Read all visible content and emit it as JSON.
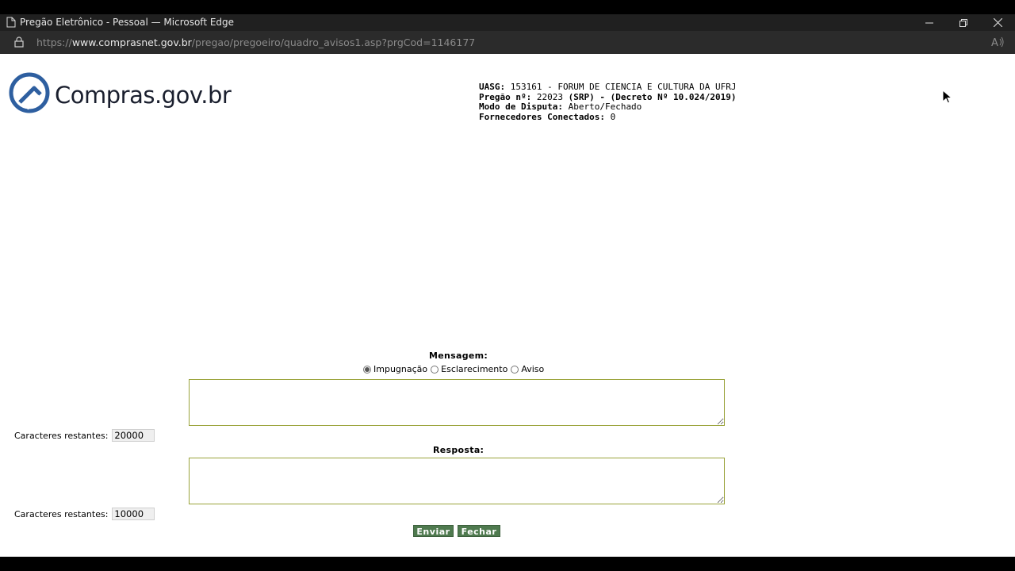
{
  "window": {
    "title": "Pregão Eletrônico - Pessoal — Microsoft Edge"
  },
  "address_bar": {
    "url_prefix": "https://",
    "url_host": "www.comprasnet.gov.br",
    "url_path": "/pregao/pregoeiro/quadro_avisos1.asp?prgCod=1146177"
  },
  "logo": {
    "text": "Compras.gov.br",
    "color": "#2e5fa0"
  },
  "info": {
    "uasg_label": "UASG:",
    "uasg_value": " 153161 - FORUM DE CIENCIA E CULTURA DA UFRJ",
    "pregao_label": "Pregão nº:",
    "pregao_number": " 22023 ",
    "pregao_extra": "(SRP) - (Decreto Nº 10.024/2019)",
    "modo_label": "Modo de Disputa:",
    "modo_value": " Aberto/Fechado",
    "fornecedores_label": "Fornecedores Conectados:",
    "fornecedores_value": " 0"
  },
  "form": {
    "mensagem_label": "Mensagem:",
    "message_type_options": [
      {
        "label": "Impugnação",
        "selected": true
      },
      {
        "label": "Esclarecimento",
        "selected": false
      },
      {
        "label": "Aviso",
        "selected": false
      }
    ],
    "chars_label": "Caracteres restantes:",
    "mensagem_chars_remaining": "20000",
    "resposta_label": "Resposta:",
    "resposta_chars_remaining": "10000",
    "enviar_label": "Enviar",
    "fechar_label": "Fechar",
    "button_color": "#4f7a4f"
  }
}
